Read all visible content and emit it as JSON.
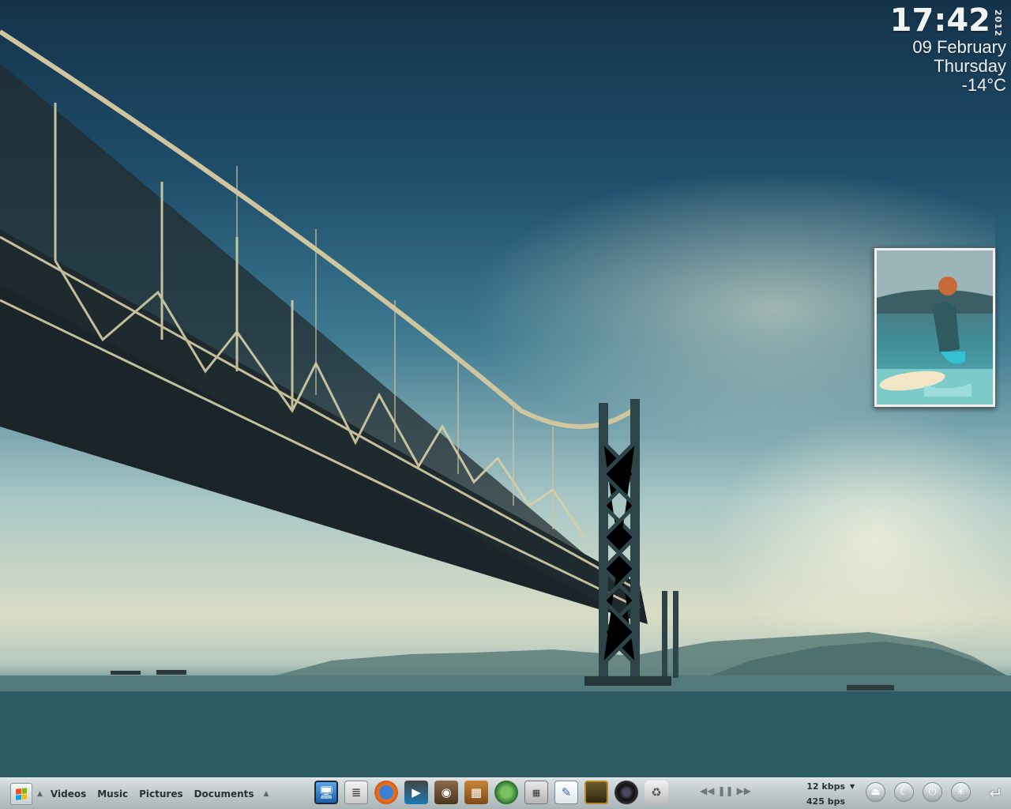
{
  "widgets": {
    "clock": {
      "time": "17:42",
      "year": "2012",
      "date": "09 February",
      "weekday": "Thursday",
      "temperature": "-14°C"
    }
  },
  "taskbar": {
    "start_icon": "windows-logo-icon",
    "places": [
      "Videos",
      "Music",
      "Pictures",
      "Documents"
    ],
    "dock_icons": [
      "monitor-icon",
      "mixer-icon",
      "firefox-icon",
      "media-player-icon",
      "speaker-icon",
      "archive-icon",
      "globe-icon",
      "calculator-icon",
      "notepad-icon",
      "mona-lisa-icon",
      "camera-lens-icon",
      "recycle-bin-icon"
    ],
    "media": [
      "previous-icon",
      "pause-icon",
      "next-icon"
    ],
    "net_down": "12 kbps",
    "net_up": "425 bps",
    "system_buttons": [
      "eject-icon",
      "sleep-icon",
      "power-icon",
      "settings-icon"
    ],
    "return_icon": "return-icon"
  }
}
